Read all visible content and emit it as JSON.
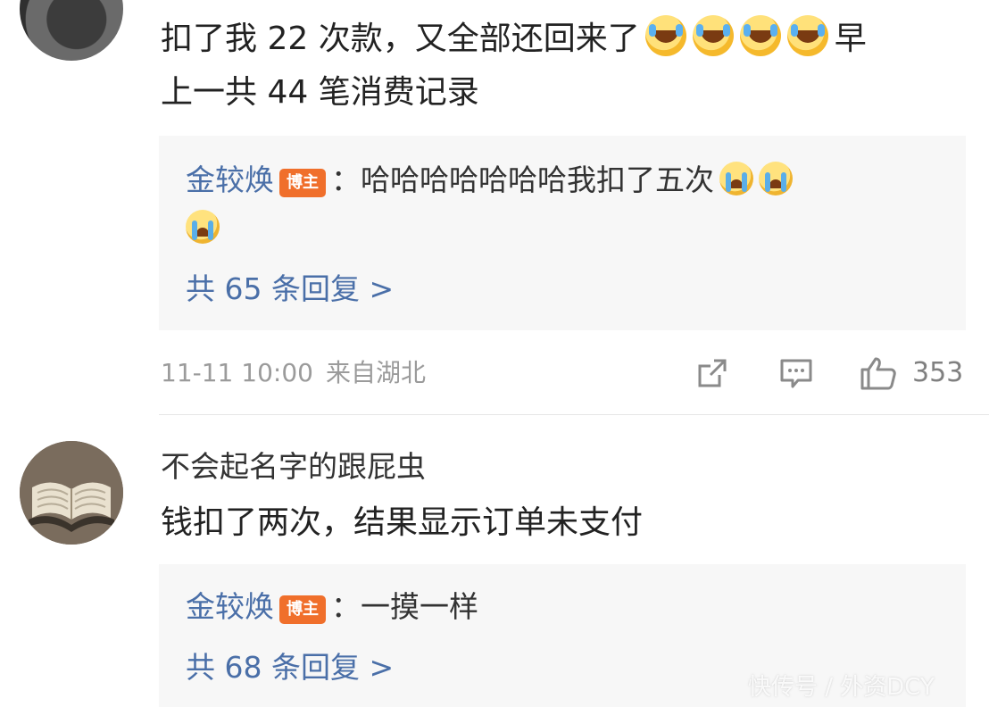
{
  "comments": [
    {
      "text_line1_before": "扣了我 22 次款，又全部还回来了",
      "text_line1_after": "早",
      "text_line2": "上一共 44 笔消费记录",
      "emoji_name": "laugh-cry-emoji",
      "reply": {
        "author": "金较焕",
        "badge": "博主",
        "separator": "：",
        "text": "哈哈哈哈哈哈哈我扣了五次",
        "emoji_name": "crying-emoji",
        "more": "共 65 条回复 >"
      },
      "meta": {
        "date": "11-11 10:00",
        "location": "来自湖北",
        "like_count": "353"
      }
    },
    {
      "username": "不会起名字的跟屁虫",
      "text": "钱扣了两次，结果显示订单未支付",
      "reply": {
        "author": "金较焕",
        "badge": "博主",
        "separator": "：",
        "text": "一摸一样",
        "more": "共 68 条回复 >"
      }
    }
  ],
  "icons": {
    "share": "share-icon",
    "comment": "comment-icon",
    "like": "like-icon"
  },
  "watermark": "快传号 / 外资DCY",
  "colors": {
    "link": "#4a6fa8",
    "badge": "#f06f2b",
    "reply_bg": "#f7f7f7",
    "meta": "#9b9b9b"
  }
}
